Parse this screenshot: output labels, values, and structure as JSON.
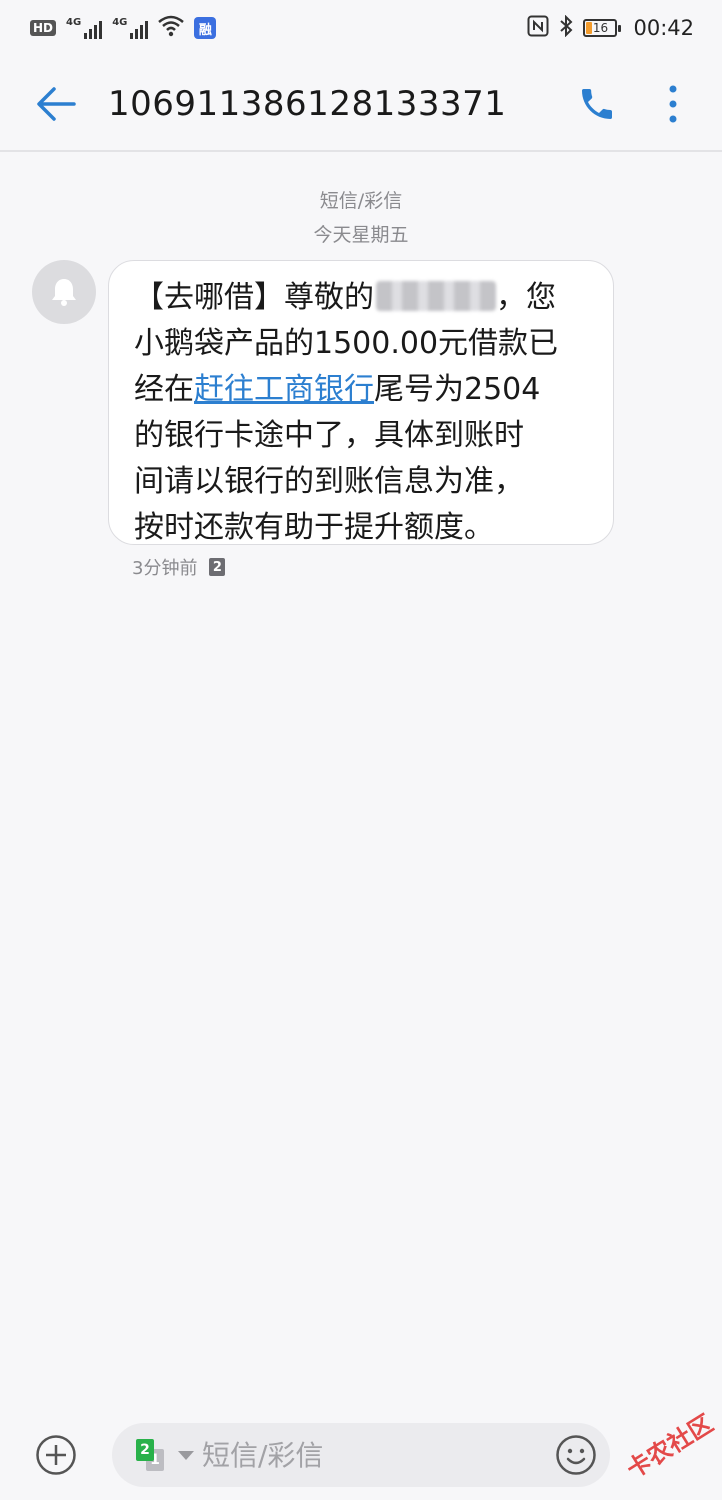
{
  "status_bar": {
    "hd": "HD",
    "network_1": "4G",
    "network_2": "4G",
    "app_badge": "融",
    "battery": "16",
    "time": "00:42"
  },
  "header": {
    "title": "106911386128133371"
  },
  "conversation": {
    "type_label": "短信/彩信",
    "date_label": "今天星期五",
    "message": {
      "line1_prefix": "【去哪借】尊敬的",
      "line1_suffix": "，您",
      "line2": "小鹅袋产品的1500.00元借款已",
      "line3_prefix": "经在",
      "line3_link": "赶往工商银行",
      "line3_suffix": "尾号为2504",
      "line4": "的银行卡途中了，具体到账时",
      "line5": "间请以银行的到账信息为准，",
      "line6": "按时还款有助于提升额度。",
      "time": "3分钟前",
      "sim": "2"
    }
  },
  "compose": {
    "placeholder": "短信/彩信",
    "sim_front": "2",
    "sim_back": "1"
  },
  "watermark": "卡农社区",
  "colors": {
    "accent": "#2c7fd0",
    "link": "#2c7fd0",
    "background": "#f7f7f9"
  }
}
